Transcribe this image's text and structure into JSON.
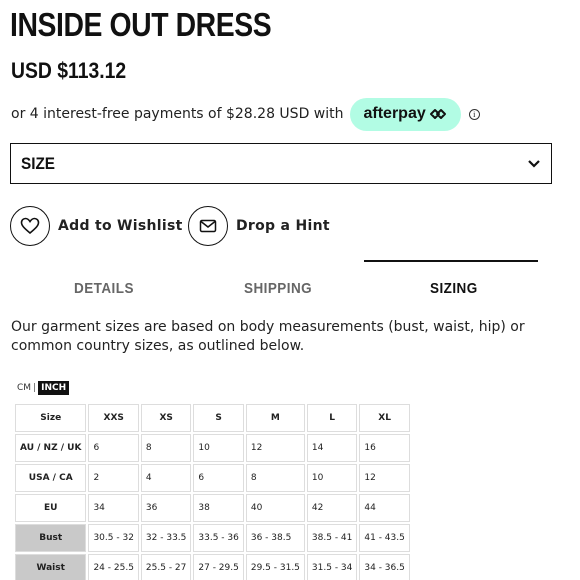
{
  "product": {
    "title": "INSIDE OUT DRESS",
    "price": "USD $113.12"
  },
  "afterpay": {
    "text": "or 4 interest-free payments of $28.28 USD with",
    "badge_label": "afterpay",
    "badge_color": "#b2fce4",
    "info_icon": "i"
  },
  "size_select": {
    "label": "SIZE",
    "icon": "chevron-down-icon"
  },
  "actions": {
    "wishlist_label": "Add to Wishlist",
    "wishlist_icon": "heart-icon",
    "hint_label": "Drop a Hint",
    "hint_icon": "envelope-icon"
  },
  "tabs": [
    {
      "label": "DETAILS",
      "active": false
    },
    {
      "label": "SHIPPING",
      "active": false
    },
    {
      "label": "SIZING",
      "active": true
    }
  ],
  "sizing": {
    "description": "Our garment sizes are based on body measurements (bust, waist, hip) or common country sizes, as outlined below.",
    "unit_cm": "CM",
    "unit_sep": "|",
    "unit_inch": "INCH",
    "table": {
      "header": [
        "Size",
        "XXS",
        "XS",
        "S",
        "M",
        "L",
        "XL"
      ],
      "rows": [
        {
          "label": "AU / NZ / UK",
          "values": [
            "6",
            "8",
            "10",
            "12",
            "14",
            "16"
          ]
        },
        {
          "label": "USA / CA",
          "values": [
            "2",
            "4",
            "6",
            "8",
            "10",
            "12"
          ]
        },
        {
          "label": "EU",
          "values": [
            "34",
            "36",
            "38",
            "40",
            "42",
            "44"
          ]
        },
        {
          "label": "Bust",
          "values": [
            "30.5 - 32",
            "32 - 33.5",
            "33.5 - 36",
            "36 - 38.5",
            "38.5 - 41",
            "41 - 43.5"
          ]
        },
        {
          "label": "Waist",
          "values": [
            "24 - 25.5",
            "25.5 - 27",
            "27 - 29.5",
            "29.5 - 31.5",
            "31.5 - 34",
            "34 - 36.5"
          ]
        }
      ]
    }
  }
}
